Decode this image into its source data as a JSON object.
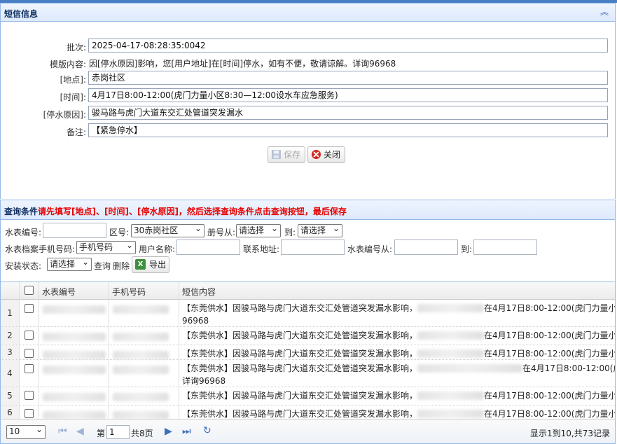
{
  "form": {
    "title": "短信信息",
    "fields": [
      {
        "label": "批次:",
        "value": "2025-04-17-08:28:35:0042",
        "boxed": true
      },
      {
        "label": "模版内容:",
        "value": "因[停水原因]影响，您[用户地址]在[时间]停水，如有不便，敬请谅解。详询96968",
        "boxed": false
      },
      {
        "label": "[地点]:",
        "value": "赤岗社区",
        "boxed": true
      },
      {
        "label": "[时间]:",
        "value": "4月17日8:00-12:00(虎门力量小区8:30—12:00设水车应急服务)",
        "boxed": true
      },
      {
        "label": "[停水原因]:",
        "value": "骏马路与虎门大道东交汇处管道突发漏水",
        "boxed": true
      },
      {
        "label": "备注:",
        "value": "【紧急停水】",
        "boxed": true
      }
    ],
    "save_label": "保存",
    "close_label": "关闭"
  },
  "query": {
    "title": "查询条件",
    "hint": "请先填写[地点]、[时间]、[停水原因]，然后选择查询条件点击查询按钮，最后保存",
    "meter_no_label": "水表编号:",
    "area_label": "区号:",
    "area_value": "30赤岗社区",
    "book_from_label": "册号从:",
    "book_from_value": "请选择",
    "to_label": "到:",
    "book_to_value": "请选择",
    "phone_label": "水表档案手机号码:",
    "phone_value": "手机号码",
    "username_label": "用户名称:",
    "address_label": "联系地址:",
    "meter_from_label": "水表编号从:",
    "meter_to_label": "到:",
    "install_label": "安装状态:",
    "install_value": "请选择",
    "search_label": "查询",
    "delete_label": "删除",
    "export_label": "导出"
  },
  "grid": {
    "columns": [
      "水表编号",
      "手机号码",
      "短信内容"
    ],
    "rows": [
      {
        "num": "1",
        "line1": "【东莞供水】因骏马路与虎门大道东交汇处管道突发漏水影响，",
        "line1b": "在4月17日8:00-12:00(虎门力量小",
        "line2": "96968"
      },
      {
        "num": "2",
        "line1": "【东莞供水】因骏马路与虎门大道东交汇处管道突发漏水影响，",
        "line1b": "在4月17日8:00-12:00(虎门力量小区",
        "line2": ""
      },
      {
        "num": "3",
        "line1": "【东莞供水】因骏马路与虎门大道东交汇处管道突发漏水影响，",
        "line1b": "在4月17日8:00-12:00(虎门力量小区",
        "line2": ""
      },
      {
        "num": "4",
        "line1": "【东莞供水】因骏马路与虎门大道东交汇处管道突发漏水影响，",
        "line1b": "在4月17日8:00-12:00(虎",
        "line2": "详询96968"
      },
      {
        "num": "5",
        "line1": "【东莞供水】因骏马路与虎门大道东交汇处管道突发漏水影响，",
        "line1b": "在4月17日8:00-12:00(虎门力量小区",
        "line2": ""
      },
      {
        "num": "6",
        "line1": "【东莞供水】因骏马路与虎门大道东交汇处管道突发漏水影响，",
        "line1b": "在4月17日8:00-12:00(虎门力量小区",
        "line2": ""
      }
    ]
  },
  "pager": {
    "page_size": "10",
    "page_label": "第",
    "page_value": "1",
    "total_pages": "共8页",
    "summary": "显示1到10,共73记录"
  },
  "colors": {
    "accent": "#95b8e7",
    "hint_red": "#e60000",
    "header_blue": "#0e2d5f"
  }
}
